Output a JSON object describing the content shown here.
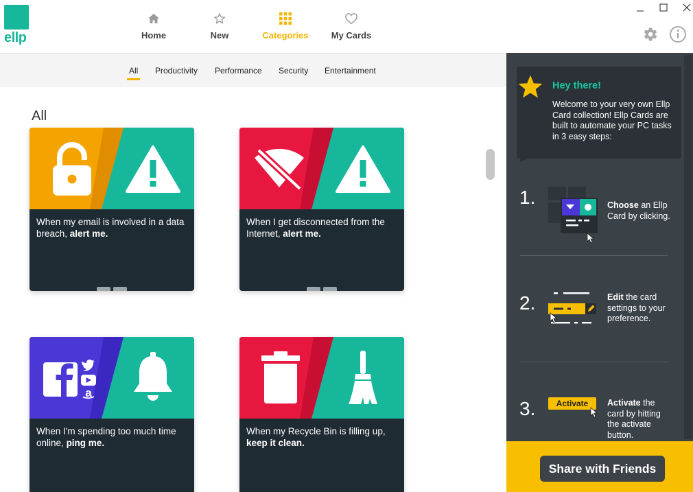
{
  "brand": {
    "name": "ellp",
    "color": "#17b79b"
  },
  "nav": [
    {
      "label": "Home",
      "icon": "home-icon"
    },
    {
      "label": "New",
      "icon": "star-outline-icon"
    },
    {
      "label": "Categories",
      "icon": "grid-icon",
      "active": true
    },
    {
      "label": "My Cards",
      "icon": "heart-outline-icon"
    }
  ],
  "subtabs": [
    "All",
    "Productivity",
    "Performance",
    "Security",
    "Entertainment"
  ],
  "active_subtab": "All",
  "section_title": "All",
  "cards": [
    {
      "text": "When my email is involved in a data breach,",
      "bold": "alert me.",
      "left_color": "#f4a300",
      "right_color": "#17b79b",
      "left_icon": "unlocked-padlock-icon",
      "right_icon": "warning-icon"
    },
    {
      "text": "When I get disconnected from the Internet,",
      "bold": "alert me.",
      "left_color": "#e8173f",
      "right_color": "#17b79b",
      "left_icon": "wifi-off-icon",
      "right_icon": "warning-icon"
    },
    {
      "text": "When I'm spending too much time online,",
      "bold": "ping me.",
      "left_color": "#4a37d6",
      "right_color": "#17b79b",
      "left_icon": "social-media-icon",
      "right_icon": "bell-icon"
    },
    {
      "text": "When my Recycle Bin is filling up,",
      "bold": "keep it clean.",
      "left_color": "#e8173f",
      "right_color": "#17b79b",
      "left_icon": "trash-bin-icon",
      "right_icon": "broom-icon"
    }
  ],
  "sidebar": {
    "greeting": "Hey there!",
    "welcome": "Welcome to your very own Ellp Card collection! Ellp Cards are built to automate your PC tasks in 3 easy steps:",
    "steps": [
      {
        "num": "1.",
        "bold": "Choose",
        "rest": " an Ellp Card by clicking."
      },
      {
        "num": "2.",
        "bold": "Edit",
        "rest": " the card settings to your preference."
      },
      {
        "num": "3.",
        "bold": "Activate",
        "rest": " the card by hitting the activate button.",
        "badge": "Activate"
      }
    ],
    "share_label": "Share with Friends",
    "accent": "#f7bf00"
  }
}
